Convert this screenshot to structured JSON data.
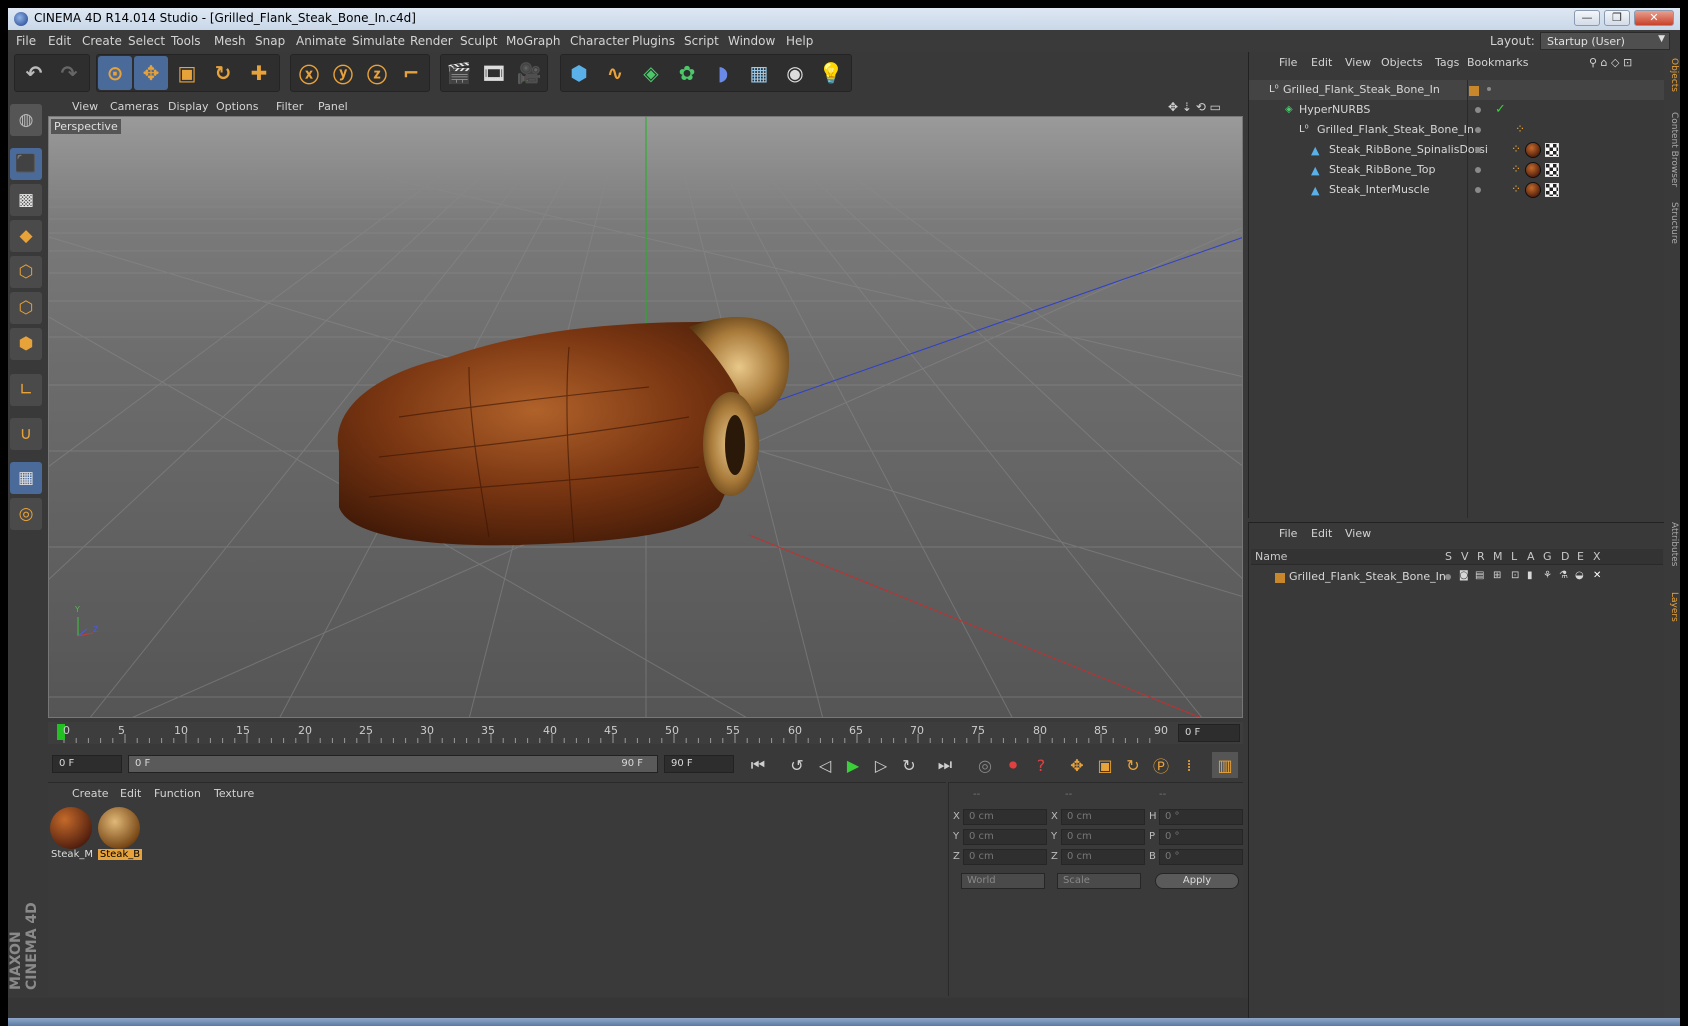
{
  "window": {
    "title": "CINEMA 4D R14.014 Studio - [Grilled_Flank_Steak_Bone_In.c4d]",
    "minimize": "—",
    "maximize": "❐",
    "close": "✕"
  },
  "menubar": {
    "items": [
      "File",
      "Edit",
      "Create",
      "Select",
      "Tools",
      "Mesh",
      "Snap",
      "Animate",
      "Simulate",
      "Render",
      "Sculpt",
      "MoGraph",
      "Character",
      "Plugins",
      "Script",
      "Window",
      "Help"
    ],
    "layout_label": "Layout:",
    "layout_value": "Startup (User)"
  },
  "viewport": {
    "menu": [
      "View",
      "Cameras",
      "Display",
      "Options",
      "Filter",
      "Panel"
    ],
    "camera_label": "Perspective",
    "axis_y": "Y",
    "axis_z": "Z"
  },
  "timeline": {
    "ticks": [
      "0",
      "5",
      "10",
      "15",
      "20",
      "25",
      "30",
      "35",
      "40",
      "45",
      "50",
      "55",
      "60",
      "65",
      "70",
      "75",
      "80",
      "85",
      "90"
    ],
    "current_frame": "0 F",
    "start_frame": "0 F",
    "range_start": "0 F",
    "range_end": "90 F",
    "end_frame": "90 F"
  },
  "materials": {
    "menu": [
      "Create",
      "Edit",
      "Function",
      "Texture"
    ],
    "items": [
      {
        "label": "Steak_M",
        "selected": false
      },
      {
        "label": "Steak_B",
        "selected": true
      }
    ]
  },
  "coords": {
    "headers": [
      "--",
      "--",
      "--"
    ],
    "rows": [
      {
        "l1": "X",
        "v1": "0 cm",
        "l2": "X",
        "v2": "0 cm",
        "l3": "H",
        "v3": "0 °"
      },
      {
        "l1": "Y",
        "v1": "0 cm",
        "l2": "Y",
        "v2": "0 cm",
        "l3": "P",
        "v3": "0 °"
      },
      {
        "l1": "Z",
        "v1": "0 cm",
        "l2": "Z",
        "v2": "0 cm",
        "l3": "B",
        "v3": "0 °"
      }
    ],
    "world": "World",
    "scale": "Scale",
    "apply": "Apply"
  },
  "object_manager": {
    "menu": [
      "File",
      "Edit",
      "View",
      "Objects",
      "Tags",
      "Bookmarks"
    ],
    "objects": [
      {
        "name": "Grilled_Flank_Steak_Bone_In",
        "type": "null-icon"
      },
      {
        "name": "HyperNURBS",
        "type": "hypernurbs-icon"
      },
      {
        "name": "Grilled_Flank_Steak_Bone_In",
        "type": "null-icon"
      },
      {
        "name": "Steak_RibBone_SpinalisDorsi",
        "type": "polygon-icon"
      },
      {
        "name": "Steak_RibBone_Top",
        "type": "polygon-icon"
      },
      {
        "name": "Steak_InterMuscle",
        "type": "polygon-icon"
      }
    ]
  },
  "layer_manager": {
    "menu": [
      "File",
      "Edit",
      "View"
    ],
    "columns": [
      "Name",
      "S",
      "V",
      "R",
      "M",
      "L",
      "A",
      "G",
      "D",
      "E",
      "X"
    ],
    "layers": [
      {
        "name": "Grilled_Flank_Steak_Bone_In",
        "color": "#c8872a"
      }
    ]
  },
  "right_tabs": [
    "Objects",
    "Content Browser",
    "Structure",
    "Attributes",
    "Layers"
  ],
  "brand": "MAXON CINEMA 4D",
  "colors": {
    "accent": "#e8a23a",
    "selection": "#4a6a9a",
    "grid_green": "#1bb31b",
    "grid_red": "#c03030",
    "grid_blue": "#3040c8"
  }
}
